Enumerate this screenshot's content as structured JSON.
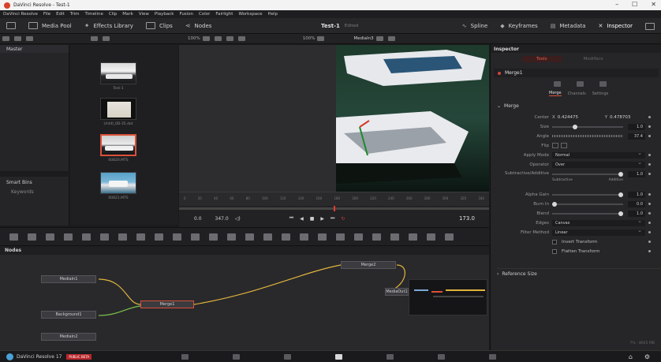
{
  "window": {
    "title": "DaVinci Resolve - Test-1",
    "controls": [
      "–",
      "☐",
      "✕"
    ]
  },
  "menu": [
    "DaVinci Resolve",
    "File",
    "Edit",
    "Trim",
    "Timeline",
    "Clip",
    "Mark",
    "View",
    "Playback",
    "Fusion",
    "Color",
    "Fairlight",
    "Workspace",
    "Help"
  ],
  "toolbar": {
    "media_pool": "Media Pool",
    "effects_library": "Effects Library",
    "clips": "Clips",
    "nodes": "Nodes",
    "project": "Test-1",
    "project_status": "Edited",
    "spline": "Spline",
    "keyframes": "Keyframes",
    "metadata": "Metadata",
    "inspector": "Inspector"
  },
  "subtoolbar": {
    "zoom_left": "100%",
    "zoom_right": "100%",
    "viewer_node": "MediaIn3"
  },
  "bins": {
    "master": "Master",
    "smart_bins": "Smart Bins",
    "keywords": "Keywords"
  },
  "clips": [
    {
      "name": "Test-1"
    },
    {
      "name": "Untitl_0D-35.dot"
    },
    {
      "name": "00820.MTS"
    },
    {
      "name": "00821.MTS"
    }
  ],
  "transport": {
    "in_time": "0.0",
    "out_time": "347.0",
    "current": "173.0"
  },
  "ruler_ticks": [
    "0",
    "20",
    "40",
    "60",
    "80",
    "100",
    "120",
    "140",
    "160",
    "180",
    "200",
    "220",
    "240",
    "260",
    "280",
    "300",
    "320",
    "340"
  ],
  "nodes": {
    "header": "Nodes",
    "items": [
      "MediaIn1",
      "Background1",
      "Merge1",
      "Merge2",
      "MediaIn2",
      "MediaOut1"
    ]
  },
  "inspector": {
    "header": "Inspector",
    "tabs": [
      "Tools",
      "Modifiers"
    ],
    "node_name": "Merge1",
    "subtabs": [
      "Merge",
      "Channels",
      "Settings"
    ],
    "section": "Merge",
    "center_x_label": "X",
    "center_x": "0.424475",
    "center_y_label": "Y",
    "center_y": "0.478703",
    "size": "1.0",
    "angle": "37.4",
    "labels": {
      "center": "Center",
      "size": "Size",
      "angle": "Angle",
      "flip": "Flip",
      "apply_mode": "Apply Mode",
      "operator": "Operator",
      "sub_add": "Subtractive/Additive",
      "alpha_gain": "Alpha Gain",
      "burn_in": "Burn In",
      "blend": "Blend",
      "edges": "Edges",
      "filter_method": "Filter Method"
    },
    "apply_mode": "Normal",
    "operator": "Over",
    "sub_add_value": "1.0",
    "subtractive": "Subtractive",
    "additive": "Additive",
    "alpha_gain": "1.0",
    "burn_in": "0.0",
    "blend": "1.0",
    "edges": "Canvas",
    "filter_method": "Linear",
    "invert_transform": "Invert Transform",
    "flatten_transform": "Flatten Transform",
    "reference_size": "Reference Size"
  },
  "statusbar": {
    "app": "DaVinci Resolve 17",
    "badge": "PUBLIC BETA",
    "memory": "7% - 8645 MB"
  },
  "colors": {
    "accent": "#d9513a",
    "play_head": "#e23b2b",
    "link_yellow": "#e0b43a",
    "link_green": "#7cc24a"
  }
}
